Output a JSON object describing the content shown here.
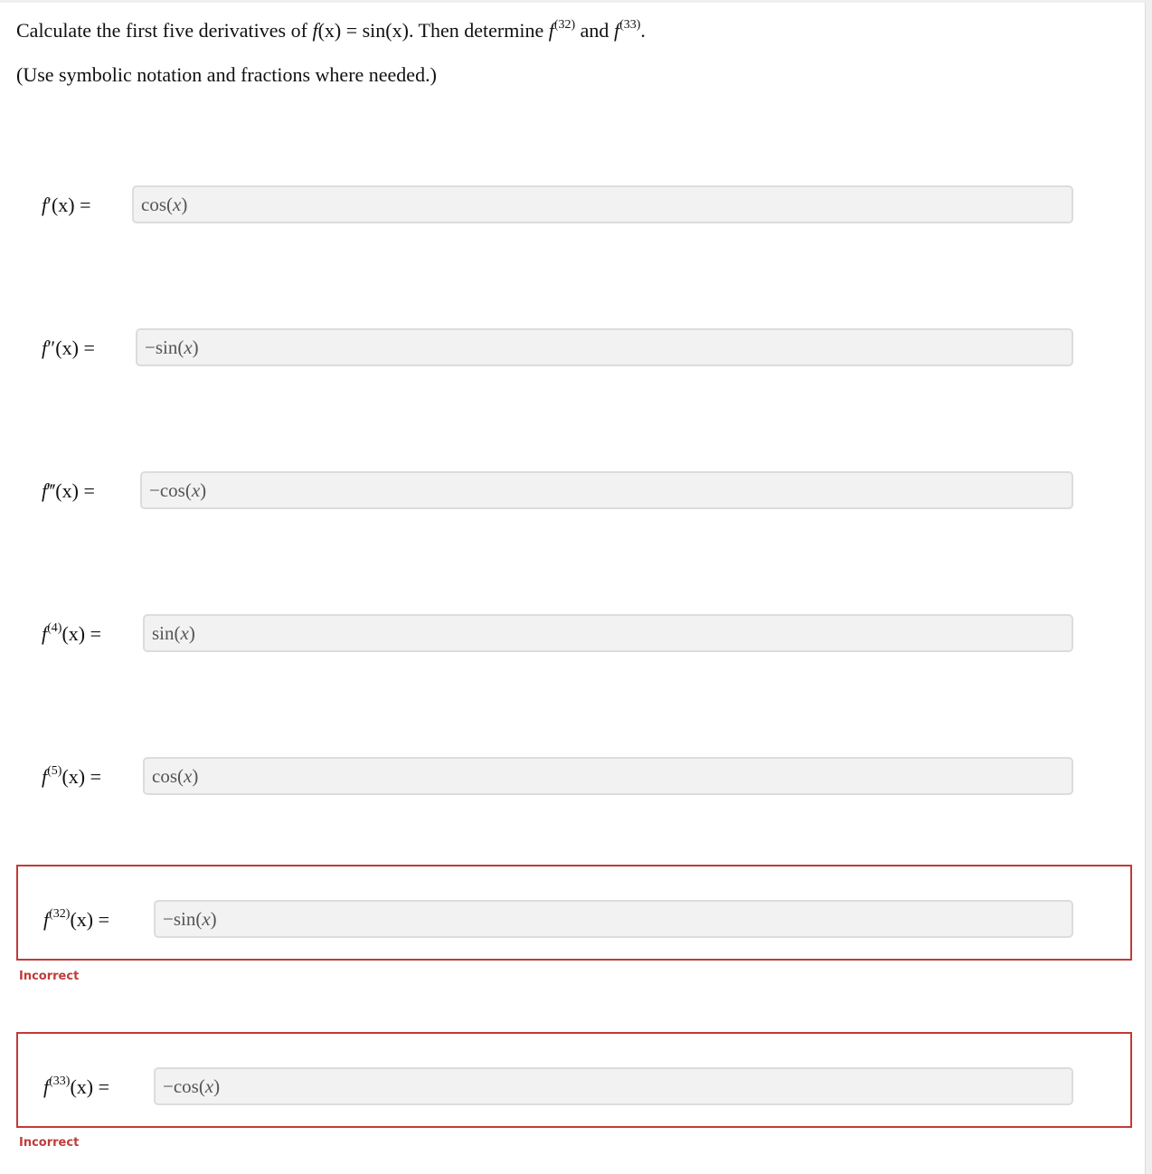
{
  "question": {
    "text_pre": "Calculate the first five derivatives of ",
    "func": "f",
    "func_arg": "(x) = sin(x). Then determine ",
    "order_a": "(32)",
    "conj": " and ",
    "order_b": "(33)",
    "text_end": ".",
    "note": "(Use symbolic notation and fractions where needed.)"
  },
  "answers": [
    {
      "label_fn": "f",
      "label_mark": "′",
      "label_rest": "(x) =",
      "value": "cos(x)",
      "status": "none"
    },
    {
      "label_fn": "f",
      "label_mark": "″",
      "label_rest": "(x) =",
      "value": "−sin(x)",
      "status": "none"
    },
    {
      "label_fn": "f",
      "label_mark": "‴",
      "label_rest": "(x) =",
      "value": "−cos(x)",
      "status": "none"
    },
    {
      "label_fn": "f",
      "label_mark": "(4)",
      "label_rest": "(x) =",
      "value": "sin(x)",
      "status": "none"
    },
    {
      "label_fn": "f",
      "label_mark": "(5)",
      "label_rest": "(x) =",
      "value": "cos(x)",
      "status": "none"
    },
    {
      "label_fn": "f",
      "label_mark": "(32)",
      "label_rest": "(x) =",
      "value": "−sin(x)",
      "status": "Incorrect"
    },
    {
      "label_fn": "f",
      "label_mark": "(33)",
      "label_rest": "(x) =",
      "value": "−cos(x)",
      "status": "Incorrect"
    }
  ],
  "colors": {
    "incorrect": "#c13a3a",
    "field_bg": "#f2f2f2"
  }
}
